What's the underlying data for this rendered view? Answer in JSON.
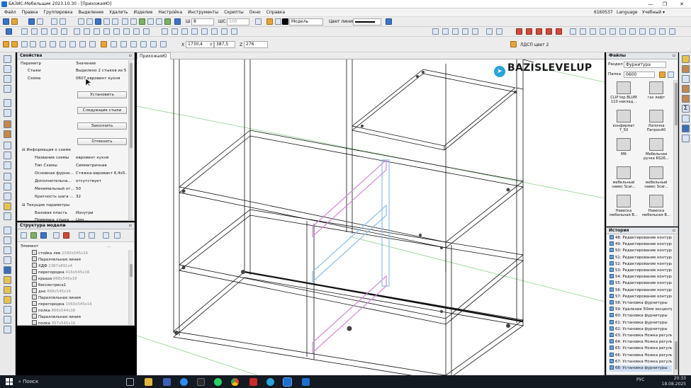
{
  "window": {
    "title": "БАЗИС-Мебельщик 2023.10.30 - [ПрихожаяЮ]",
    "min": "—",
    "max": "❐",
    "close": "✕"
  },
  "menu": {
    "items": [
      "Файл",
      "Правка",
      "Группировка",
      "Выделение",
      "Удалить",
      "Изделие",
      "Настройка",
      "Инструменты",
      "Скрипты",
      "Окно",
      "Справка"
    ],
    "user_id": "6160537",
    "language": "Language",
    "mode": "Учебный ▾"
  },
  "toolbar": {
    "sh_label": "Ш",
    "sh_value": "8",
    "shc_label": "ШС",
    "shc_value": "100",
    "model_label": "Модель",
    "line_color_label": "Цвет линии",
    "x_label": "X",
    "x_value": "1730,4",
    "y_label": "Y",
    "y_value": "387,5",
    "z_label": "Z",
    "z_value": "276",
    "material": "ЛДСП цвет 2"
  },
  "properties": {
    "title": "Свойства",
    "col_param": "Параметр",
    "col_value": "Значение",
    "rows": [
      {
        "k": "Стыки",
        "v": "Выделено 2 стыков из 5"
      },
      {
        "k": "Схема",
        "v": "0607 евровинт кухня"
      }
    ],
    "buttons": {
      "install": "Установить",
      "next": "Следующие стыки",
      "finish": "Закончить",
      "cancel": "Отменить"
    },
    "section_scheme": "Информация о схеме",
    "scheme_rows": [
      {
        "k": "Название схемы",
        "v": "евровинт кухня"
      },
      {
        "k": "Тип Схемы",
        "v": "Симметричная"
      },
      {
        "k": "Основная фурни...",
        "v": "Стяжка-евровинт 6,4х5..."
      },
      {
        "k": "Дополнительна...",
        "v": "отсутствует"
      },
      {
        "k": "Минимальный от...",
        "v": "50"
      },
      {
        "k": "Кратность шага ...",
        "v": "32"
      }
    ],
    "section_current": "Текущие параметры",
    "current_rows": [
      {
        "k": "Базовая пласть",
        "v": "Изнутри"
      },
      {
        "k": "Привязка_стыка",
        "v": "Цен..."
      }
    ]
  },
  "structure": {
    "title": "Структура модели",
    "col_element": "Элемент",
    "items": [
      {
        "name": "стойка лев",
        "dim": "2390x545x16"
      },
      {
        "name": "Параллельная линия",
        "dim": ""
      },
      {
        "name": "ХДФ",
        "dim": "2387x891x4"
      },
      {
        "name": "перегородка",
        "dim": "416x545x16"
      },
      {
        "name": "крыша",
        "dim": "868x545x16"
      },
      {
        "name": "биссектриса1",
        "dim": ""
      },
      {
        "name": "дно",
        "dim": "868x545x16"
      },
      {
        "name": "Параллельная линия",
        "dim": ""
      },
      {
        "name": "перегородка",
        "dim": "1560x545x16"
      },
      {
        "name": "полка",
        "dim": "868x544x16"
      },
      {
        "name": "Параллельная линия",
        "dim": ""
      },
      {
        "name": "полка",
        "dim": "357x545x16"
      }
    ]
  },
  "viewport": {
    "tab": "ПрихожаяЮ",
    "watermark": "BAZISLEVELUP"
  },
  "files": {
    "title": "Файлы",
    "section_label": "Раздел",
    "section_value": "Фурнитура",
    "folder_label": "Папка",
    "folder_value": "0600",
    "tiles": [
      "CLIP top BLUM 110 наклад...",
      "газ лифт",
      "конфирмат 7_50",
      "Лапочка Патрон40",
      "М6",
      "Мебельная ручка RS26...",
      "мебельный навес Scar...",
      "мебельный навес Scar...",
      "Навеска мебельная В...",
      "Навеска мебельная В..."
    ]
  },
  "history": {
    "title": "История",
    "items": [
      "48: Редактирование контура и с",
      "49: Редактирование контура и с",
      "50: Редактирование контура и с",
      "51: Редактирование контура и с",
      "52: Редактирование контура и с",
      "53: Редактирование контура и с",
      "54: Редактирование контура и с",
      "55: Редактирование контура и с",
      "56: Редактирование контура и с",
      "57: Редактирование контура и с",
      "58: Установка фурнитуры",
      "59: Удаление 50мм эксцентр",
      "60: Установка фурнитуры",
      "61: Установка фурнитуры",
      "62: Установка фурнитуры",
      "63: Установка Ножка регулируе",
      "64: Установка Ножка регулируе",
      "65: Установка Ножка регулируе",
      "66: Установка Ножка регулируе",
      "67: Установка Ножка регулируе",
      "68: Установка фурнитуры"
    ]
  },
  "taskbar": {
    "search": "Поиск",
    "lang": "РУС",
    "time": "20:33",
    "date": "18.08.2025"
  }
}
